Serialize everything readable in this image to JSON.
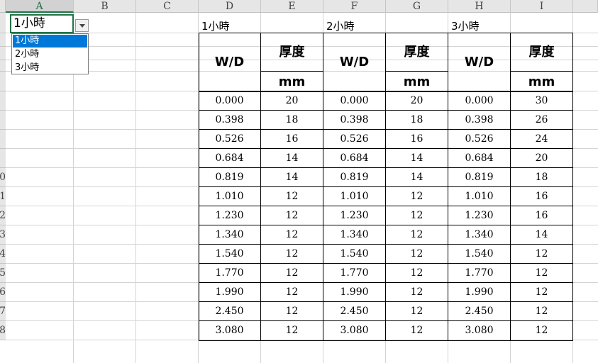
{
  "columns": [
    "A",
    "B",
    "C",
    "D",
    "E",
    "F",
    "G",
    "H",
    "I"
  ],
  "rows": [
    "",
    "",
    "",
    "",
    "",
    "",
    "",
    "",
    "",
    "0",
    "1",
    "2",
    "3",
    "4",
    "5",
    "6",
    "7",
    "8"
  ],
  "active_column": "A",
  "dropdown": {
    "value": "1小時",
    "options": [
      "1小時",
      "2小時",
      "3小時"
    ],
    "selected_index": 0,
    "highlight_color": "#0078d7"
  },
  "tables": [
    {
      "title": "1小時",
      "header_wd": "W/D",
      "header_thickness": "厚度",
      "unit": "mm"
    },
    {
      "title": "2小時",
      "header_wd": "W/D",
      "header_thickness": "厚度",
      "unit": "mm"
    },
    {
      "title": "3小時",
      "header_wd": "W/D",
      "header_thickness": "厚度",
      "unit": "mm"
    }
  ],
  "data_rows": [
    [
      "0.000",
      "20",
      "0.000",
      "20",
      "0.000",
      "30"
    ],
    [
      "0.398",
      "18",
      "0.398",
      "18",
      "0.398",
      "26"
    ],
    [
      "0.526",
      "16",
      "0.526",
      "16",
      "0.526",
      "24"
    ],
    [
      "0.684",
      "14",
      "0.684",
      "14",
      "0.684",
      "20"
    ],
    [
      "0.819",
      "14",
      "0.819",
      "14",
      "0.819",
      "18"
    ],
    [
      "1.010",
      "12",
      "1.010",
      "12",
      "1.010",
      "16"
    ],
    [
      "1.230",
      "12",
      "1.230",
      "12",
      "1.230",
      "16"
    ],
    [
      "1.340",
      "12",
      "1.340",
      "12",
      "1.340",
      "14"
    ],
    [
      "1.540",
      "12",
      "1.540",
      "12",
      "1.540",
      "12"
    ],
    [
      "1.770",
      "12",
      "1.770",
      "12",
      "1.770",
      "12"
    ],
    [
      "1.990",
      "12",
      "1.990",
      "12",
      "1.990",
      "12"
    ],
    [
      "2.450",
      "12",
      "2.450",
      "12",
      "2.450",
      "12"
    ],
    [
      "3.080",
      "12",
      "3.080",
      "12",
      "3.080",
      "12"
    ]
  ],
  "accent_color": "#217346"
}
